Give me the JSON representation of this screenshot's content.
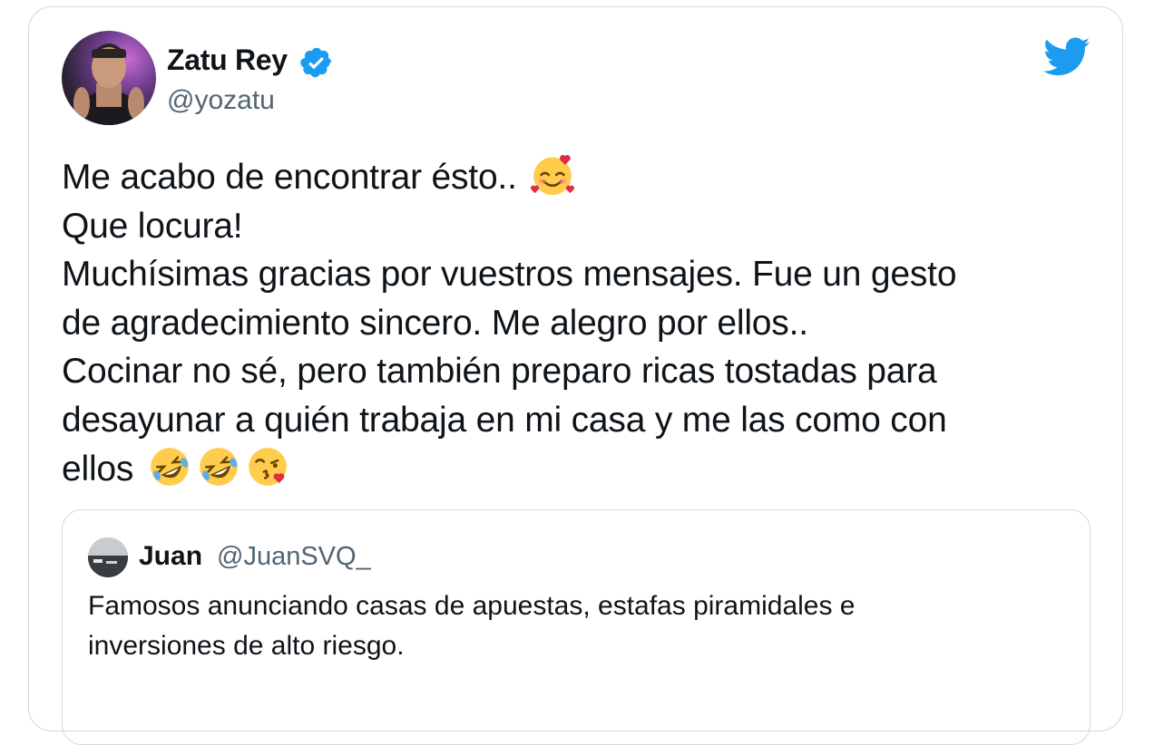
{
  "tweet": {
    "author": {
      "name": "Zatu Rey",
      "handle": "@yozatu",
      "verified": true
    },
    "text_lines": [
      "Me acabo de encontrar ésto..",
      "Que locura!",
      "Muchísimas gracias por vuestros mensajes. Fue un gesto",
      "de agradecimiento sincero. Me alegro por ellos..",
      "Cocinar no sé, pero también preparo ricas tostadas para",
      "desayunar a quién trabaja en mi casa y me las como con",
      "ellos"
    ],
    "emojis": {
      "line1": [
        "smiling-face-with-hearts"
      ],
      "line7": [
        "rolling-on-floor-laughing",
        "rolling-on-floor-laughing",
        "face-blowing-kiss"
      ]
    }
  },
  "quoted_tweet": {
    "author": {
      "name": "Juan",
      "handle": "@JuanSVQ_"
    },
    "text_lines": [
      "Famosos anunciando casas de apuestas, estafas piramidales e",
      "inversiones de alto riesgo."
    ]
  },
  "colors": {
    "twitter_blue": "#1d9bf0",
    "text_primary": "#0f1419",
    "text_secondary": "#536471",
    "border": "#cfd9de"
  },
  "icons": {
    "brand": "twitter-bird-icon",
    "verified": "verified-badge-icon"
  }
}
